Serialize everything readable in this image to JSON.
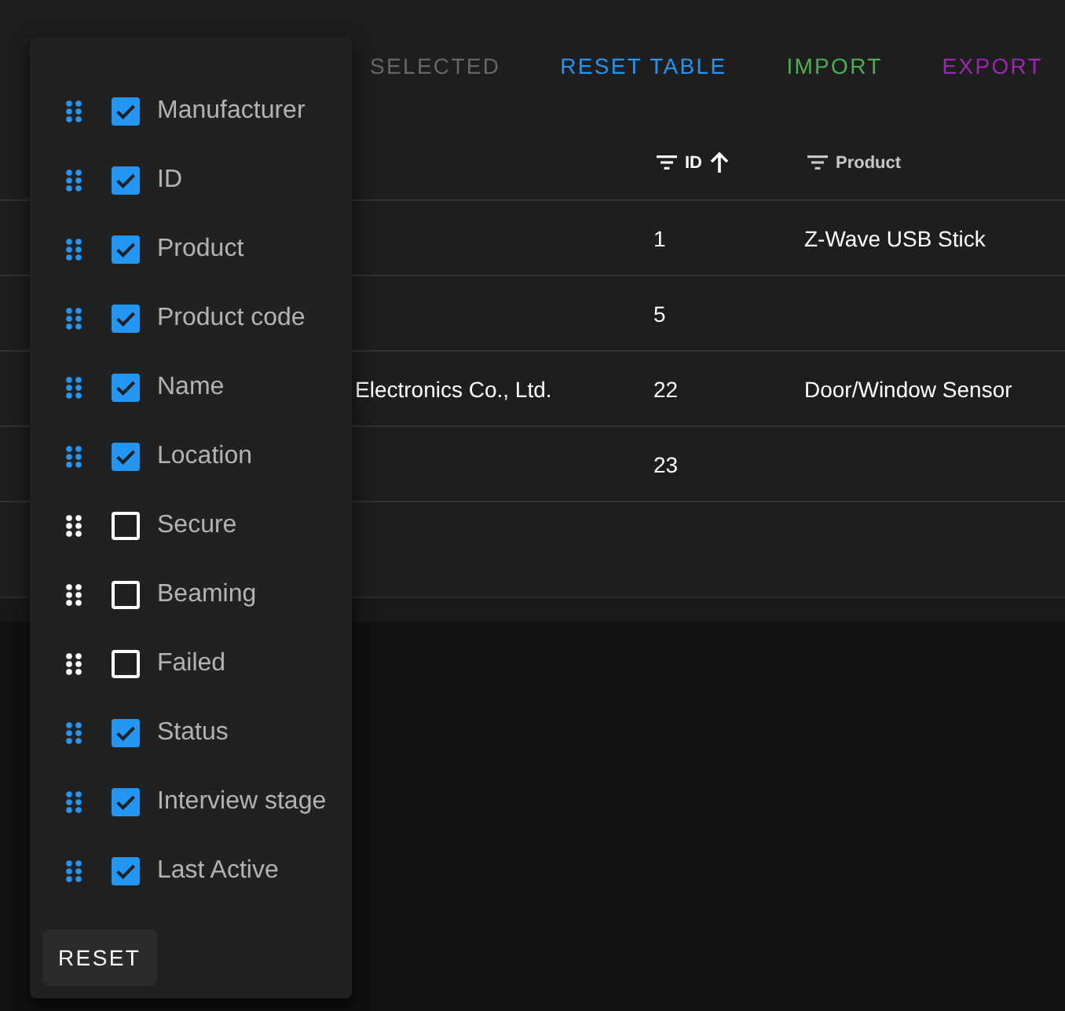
{
  "toolbar": {
    "buttons": [
      {
        "label": "SELECTED",
        "disabled": true
      },
      {
        "label": "RESET TABLE",
        "disabled": false,
        "color": "#2196f3"
      },
      {
        "label": "IMPORT",
        "disabled": false,
        "color": "#4caf50"
      },
      {
        "label": "EXPORT",
        "disabled": false,
        "color": "#9c27b0"
      }
    ]
  },
  "table": {
    "columns": [
      {
        "label": "ID",
        "sort_ascending": true
      },
      {
        "label": "Product",
        "sort_ascending": false
      }
    ],
    "rows": [
      {
        "id": "1",
        "product": "Z-Wave USB Stick"
      },
      {
        "id": "5"
      },
      {
        "column_1": "Electronics Co., Ltd.",
        "id": "22",
        "product": "Door/Window Sensor"
      },
      {
        "id": "23"
      }
    ]
  },
  "column_menu": {
    "items": [
      {
        "label": "Manufacturer",
        "checked": true
      },
      {
        "label": "ID",
        "checked": true
      },
      {
        "label": "Product",
        "checked": true
      },
      {
        "label": "Product code",
        "checked": true
      },
      {
        "label": "Name",
        "checked": true
      },
      {
        "label": "Location",
        "checked": true
      },
      {
        "label": "Secure",
        "checked": false
      },
      {
        "label": "Beaming",
        "checked": false
      },
      {
        "label": "Failed",
        "checked": false
      },
      {
        "label": "Status",
        "checked": true
      },
      {
        "label": "Interview stage",
        "checked": true
      },
      {
        "label": "Last Active",
        "checked": true
      }
    ],
    "reset_button": "RESET"
  }
}
